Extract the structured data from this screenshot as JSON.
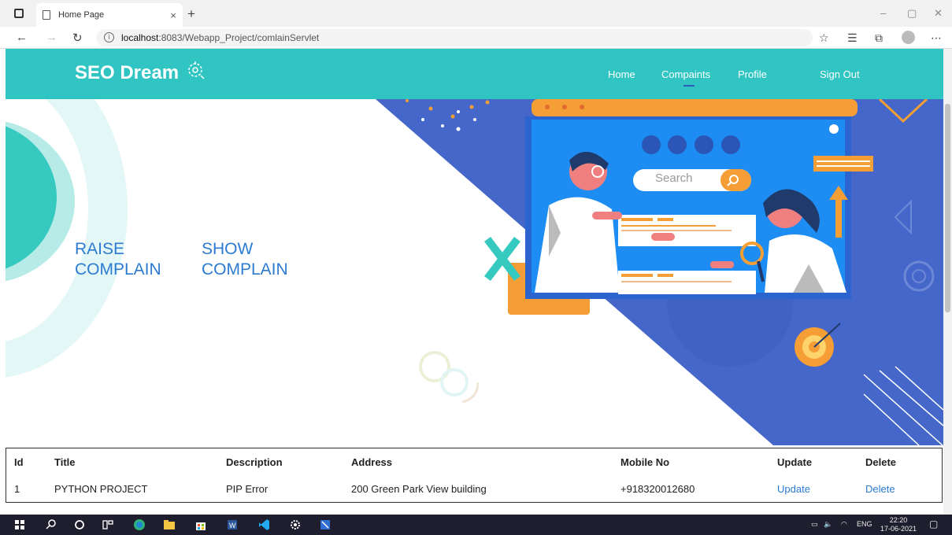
{
  "browser": {
    "tab_title": "Home Page",
    "tab_close": "×",
    "new_tab": "+",
    "url_host": "localhost",
    "url_path": ":8083/Webapp_Project/comlainServlet",
    "window_controls": [
      "–",
      "▢",
      "✕"
    ]
  },
  "header": {
    "brand": "SEO Dream",
    "nav": [
      "Home",
      "Compaints",
      "Profile",
      "Sign Out"
    ],
    "active_nav": "Compaints"
  },
  "hero": {
    "raise_link": [
      "RAISE",
      "COMPLAIN"
    ],
    "show_link": [
      "SHOW",
      "COMPLAIN"
    ],
    "search_placeholder": "Search"
  },
  "table": {
    "headers": [
      "Id",
      "Title",
      "Description",
      "Address",
      "Mobile No",
      "Update",
      "Delete"
    ],
    "rows": [
      {
        "id": "1",
        "title": "PYTHON PROJECT",
        "description": "PIP Error",
        "address": "200 Green Park View building",
        "mobile": "+918320012680",
        "update": "Update",
        "delete": "Delete"
      }
    ]
  },
  "taskbar": {
    "lang": "ENG",
    "time": "22:20",
    "date": "17-06-2021"
  },
  "colors": {
    "header": "#30c5c2",
    "link": "#2c7bd1",
    "hero_blue": "#4467c9",
    "accent_orange": "#f59e36"
  }
}
